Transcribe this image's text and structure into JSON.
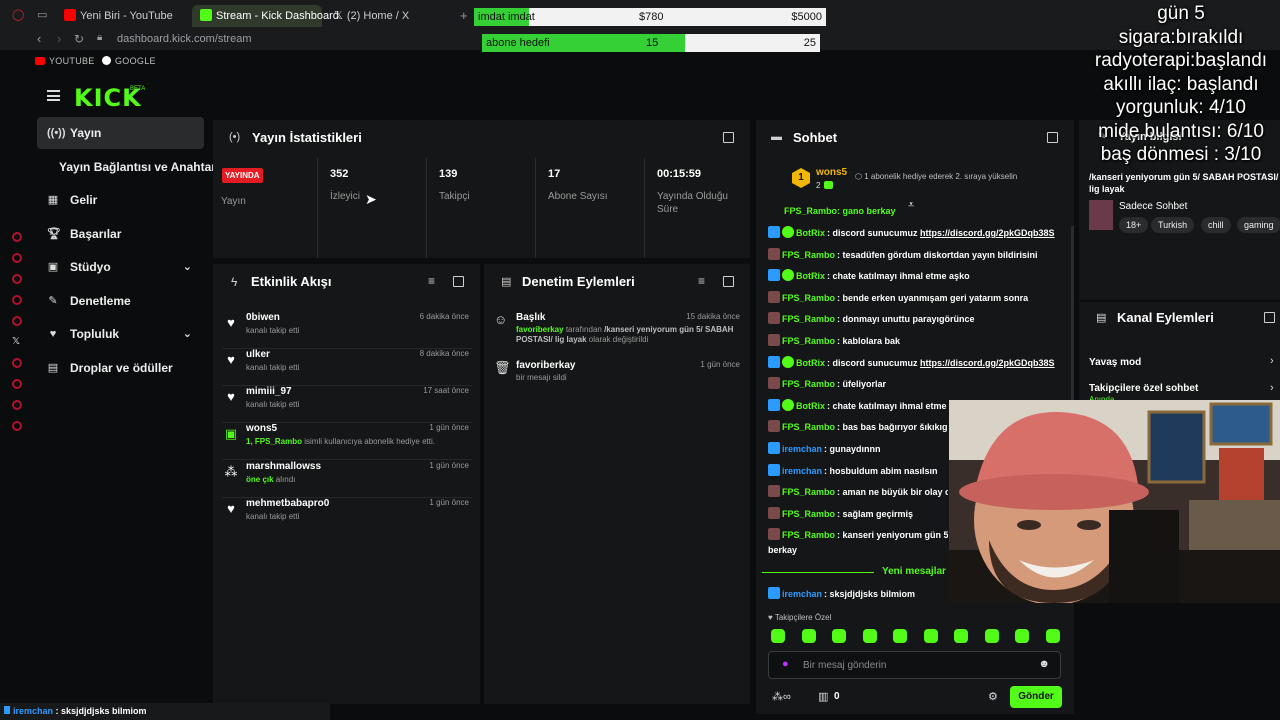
{
  "browser": {
    "tabs": [
      {
        "label": "Yeni Biri - YouTube"
      },
      {
        "label": "Stream - Kick Dashboard"
      },
      {
        "label": "(2) Home / X"
      }
    ],
    "url": "dashboard.kick.com/stream",
    "bookmarks": [
      "YOUTUBE",
      "GOOGLE"
    ]
  },
  "overlays": {
    "donation_goal": {
      "label": "imdat imdat",
      "current": "$780",
      "target": "$5000",
      "progress": 0.156
    },
    "sub_goal": {
      "label": "abone hedefi",
      "current": "15",
      "target": "25",
      "progress": 0.6
    },
    "status_lines": [
      "gün 5",
      "sigara:bırakıldı",
      "radyoterapi:başlandı",
      "akıllı ilaç: başlandı",
      "yorgunluk:  4/10",
      "mide bulantısı: 6/10",
      "baş dönmesi : 3/10"
    ]
  },
  "sidebar": {
    "items": [
      {
        "label": "Yayın"
      },
      {
        "label": "Yayın Bağlantısı ve Anahtarı"
      },
      {
        "label": "Gelir"
      },
      {
        "label": "Başarılar"
      },
      {
        "label": "Stüdyo"
      },
      {
        "label": "Denetleme"
      },
      {
        "label": "Topluluk"
      },
      {
        "label": "Droplar ve ödüller"
      }
    ]
  },
  "stats": {
    "title": "Yayın İstatistikleri",
    "live_badge": "YAYINDA",
    "items": [
      {
        "value": "",
        "label": "Yayın"
      },
      {
        "value": "352",
        "label": "İzleyici"
      },
      {
        "value": "139",
        "label": "Takipçi"
      },
      {
        "value": "17",
        "label": "Abone Sayısı"
      },
      {
        "value": "00:15:59",
        "label": "Yayında Olduğu Süre"
      }
    ]
  },
  "activity": {
    "title": "Etkinlik Akışı",
    "items": [
      {
        "name": "0biwen",
        "sub": "kanalı takip etti",
        "time": "6 dakika önce"
      },
      {
        "name": "ulker",
        "sub": "kanalı takip etti",
        "time": "8 dakika önce"
      },
      {
        "name": "mimiii_97",
        "sub": "kanalı takip etti",
        "time": "17 saat önce"
      },
      {
        "name": "wons5",
        "sub_hl": "1, FPS_Rambo",
        "sub": " isimli kullanıcıya abonelik hediye etti.",
        "time": "1 gün önce"
      },
      {
        "name": "marshmallowss",
        "sub_hl": "öne çık",
        "sub": " alındı",
        "time": "1 gün önce"
      },
      {
        "name": "mehmetbabapro0",
        "sub": "kanalı takip etti",
        "time": "1 gün önce"
      }
    ]
  },
  "moderation": {
    "title": "Denetim Eylemleri",
    "items": [
      {
        "name": "Başlık",
        "actor": "favoriberkay",
        "desc_a": " tarafından ",
        "desc_b": "/kanseri yeniyorum gün 5/ SABAH POSTASI/ lig layak",
        "desc_c": " olarak değiştirildi",
        "time": "15 dakika önce"
      },
      {
        "name": "favoriberkay",
        "desc": "bir mesajı sildi",
        "time": "1 gün önce"
      }
    ]
  },
  "chat": {
    "title": "Sohbet",
    "pinned": {
      "user": "wons5",
      "count": "2",
      "note": "1 abonelik hediye ederek 2. sıraya yükselin"
    },
    "top_partial": "FPS_Rambo: gano berkay",
    "messages": [
      {
        "user": "BotRix",
        "text": "discord sunucumuz ",
        "link": "https://discord.gg/2pkGDqb38S",
        "color": "#53fc18"
      },
      {
        "user": "FPS_Rambo",
        "text": "tesadüfen gördum diskortdan yayın bildirisini",
        "color": "#53fc18"
      },
      {
        "user": "BotRix",
        "text": "chate katılmayı ihmal etme aşko",
        "color": "#53fc18"
      },
      {
        "user": "FPS_Rambo",
        "text": "bende erken uyanmışam geri yatarım sonra",
        "color": "#53fc18"
      },
      {
        "user": "FPS_Rambo",
        "text": "donmayı unuttu parayıgörünce",
        "color": "#53fc18"
      },
      {
        "user": "FPS_Rambo",
        "text": "kablolara bak",
        "color": "#53fc18"
      },
      {
        "user": "BotRix",
        "text": "discord sunucumuz ",
        "link": "https://discord.gg/2pkGDqb38S",
        "color": "#53fc18"
      },
      {
        "user": "FPS_Rambo",
        "text": "üfeliyorlar",
        "color": "#53fc18"
      },
      {
        "user": "BotRix",
        "text": "chate katılmayı ihmal etme",
        "color": "#53fc18"
      },
      {
        "user": "FPS_Rambo",
        "text": "bas bas bağırıyor šıkıkıgı",
        "color": "#53fc18"
      },
      {
        "user": "iremchan",
        "text": "gunaydınnn",
        "color": "#2b9bff"
      },
      {
        "user": "iremchan",
        "text": "hosbuldum abim nasılsın",
        "color": "#2b9bff"
      },
      {
        "user": "FPS_Rambo",
        "text": "aman ne büyük bir olay o",
        "color": "#53fc18"
      },
      {
        "user": "FPS_Rambo",
        "text": "sağlam geçirmiş",
        "color": "#53fc18"
      },
      {
        "user": "FPS_Rambo",
        "text": "kanseri yeniyorum gün 5 sabah postasi yazmış",
        "color": "#53fc18"
      }
    ],
    "wrap_tail": "berkay",
    "new_messages_label": "Yeni mesajlar",
    "after_new": {
      "user": "iremchan",
      "text": "sksjdjdjsks bilmiom",
      "color": "#2b9bff"
    },
    "follower_only": "Takipçilere Özel",
    "input_placeholder": "Bir mesaj gönderin",
    "points": "0",
    "send_label": "Gönder"
  },
  "right": {
    "stream_info_title": "Yayın bilgisi",
    "stream_title": "/kanseri yeniyorum gün 5/ SABAH POSTASI/ lig layak",
    "category": "Sadece Sohbet",
    "tags": [
      "18+",
      "Turkish",
      "chill",
      "gaming"
    ],
    "channel_actions_title": "Kanal Eylemleri",
    "actions": [
      {
        "label": "Yavaş mod"
      },
      {
        "label": "Takipçilere özel sohbet",
        "sub": "Anında"
      }
    ]
  },
  "bottom_status": {
    "user": "iremchan",
    "text": " : sksjdjdjsks bilmiom"
  },
  "colors": {
    "accent": "#53fc18",
    "live": "#e31c24",
    "panel": "#151617",
    "bg": "#0b0c0d"
  }
}
